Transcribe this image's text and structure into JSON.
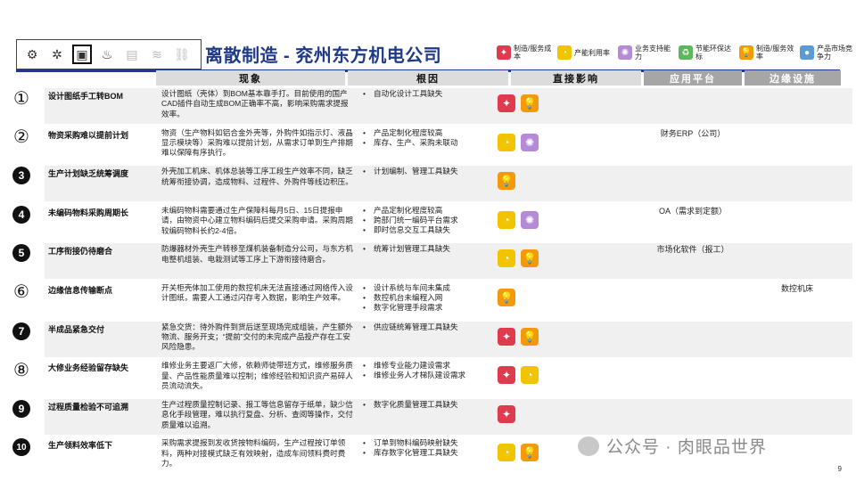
{
  "header": {
    "title": "离散制造 - 兖州东方机电公司",
    "icons": [
      "robot-arm-icon",
      "gears-icon",
      "cpu-chip-icon",
      "water-drop-icon",
      "server-icon",
      "waves-icon",
      "link-icon"
    ],
    "active_icon": "cpu-chip-icon"
  },
  "legend": [
    {
      "icon": "cost-icon",
      "label": "制造/服务成本",
      "color": "#e03a4e",
      "glyph": "✦"
    },
    {
      "icon": "capacity-icon",
      "label": "产能利用率",
      "color": "#f2c400",
      "glyph": "◔"
    },
    {
      "icon": "support-icon",
      "label": "业务支持能力",
      "color": "#b58ad6",
      "glyph": "✺"
    },
    {
      "icon": "environment-icon",
      "label": "节能环保达标",
      "color": "#5cb85c",
      "glyph": "♻"
    },
    {
      "icon": "efficiency-icon",
      "label": "制造/服务效率",
      "color": "#f39a0c",
      "glyph": "💡"
    },
    {
      "icon": "market-icon",
      "label": "产品市场竞争力",
      "color": "#5b9bd5",
      "glyph": "●"
    }
  ],
  "columns": {
    "phenomenon": "现象",
    "cause": "根因",
    "impact": "直接影响",
    "platform": "应用平台",
    "facility": "边缘设施"
  },
  "rows": [
    {
      "num": "①",
      "style": "outline",
      "problem": "设计图纸手工转BOM",
      "phenomenon": "设计图纸（壳体）到BOM基本靠手打。目前使用的国产CAD插件自动生成BOM正确率不高，影响采购需求提报效率。",
      "causes": [
        "自动化设计工具缺失"
      ],
      "impacts": [
        "cost",
        "efficiency"
      ],
      "platform": "",
      "facility": ""
    },
    {
      "num": "②",
      "style": "outline",
      "problem": "物资采购难以提前计划",
      "phenomenon": "物资（生产物料如铝合金外壳等，外购件如指示灯、液晶显示模块等）采购难以提前计划，从需求订单到生产排期难以保障有序执行。",
      "causes": [
        "产品定制化程度较高",
        "库存、生产、采购未联动"
      ],
      "impacts": [
        "capacity",
        "support"
      ],
      "platform": "财务ERP（公司）",
      "facility": ""
    },
    {
      "num": "3",
      "style": "solid",
      "problem": "生产计划缺乏统筹调度",
      "phenomenon": "外壳加工机床、机体总装等工序工段生产效率不同，缺乏统筹衔接协调，造成物料、过程件、外购件等线边积压。",
      "causes": [
        "计划编制、管理工具缺失"
      ],
      "impacts": [
        "efficiency"
      ],
      "platform": "",
      "facility": ""
    },
    {
      "num": "4",
      "style": "solid",
      "problem": "未编码物料采购周期长",
      "phenomenon": "未编码物料需要通过生产保障科每月5日、15日提报申请，由物资中心建立物料编码后提交采购申请。采购周期较编码物料长约2-4倍。",
      "causes": [
        "产品定制化程度较高",
        "跨部门统一编码平台需求",
        "即时信息交互工具缺失"
      ],
      "impacts": [
        "capacity",
        "support"
      ],
      "platform": "OA（需求到定额）",
      "facility": ""
    },
    {
      "num": "5",
      "style": "solid",
      "problem": "工序衔接仍待磨合",
      "phenomenon": "防爆器材外壳生产转移至煤机装备制造分公司，与东方机电整机组装、电栽测试等工序上下游衔接待磨合。",
      "causes": [
        "统筹计划管理工具缺失"
      ],
      "impacts": [
        "capacity",
        "efficiency"
      ],
      "platform": "市场化软件（报工）",
      "facility": ""
    },
    {
      "num": "⑥",
      "style": "outline",
      "problem": "边缘信息传输断点",
      "phenomenon": "开关柜壳体加工使用的数控机床无法直接通过网络传入设计图纸，需要人工通过闪存考入数据，影响生产效率。",
      "causes": [
        "设计系统与车间未集成",
        "数控机台未编程入网",
        "数字化管理手段需求"
      ],
      "impacts": [
        "efficiency"
      ],
      "platform": "",
      "facility": "数控机床"
    },
    {
      "num": "7",
      "style": "solid",
      "problem": "半成品紧急交付",
      "phenomenon": "紧急交货：待外购件到货后送至现场完成组装，产生额外物流、服务开支；“提前”交付的未完成产品投产存在工安风险隐患。",
      "causes": [
        "供应链统筹管理工具缺失"
      ],
      "impacts": [
        "cost",
        "efficiency"
      ],
      "platform": "",
      "facility": ""
    },
    {
      "num": "⑧",
      "style": "outline",
      "problem": "大修业务经验留存缺失",
      "phenomenon": "维修业务主要返厂大修，依赖师徒带班方式，维修服务质量、产品性能质量难以控制；维修经验和知识资产易碎人员流动流失。",
      "causes": [
        "维修专业能力建设需求",
        "维修业务人才梯队建设需求"
      ],
      "impacts": [
        "cost",
        "capacity"
      ],
      "platform": "",
      "facility": ""
    },
    {
      "num": "9",
      "style": "solid",
      "problem": "过程质量检验不可追溯",
      "phenomenon": "生产过程质量控制记录、报工等信息留存于纸单，缺少信息化手段管理，难以执行复盘、分析、查阅等操作，交付质量难以追溯。",
      "causes": [
        "数字化质量管理工具缺失"
      ],
      "impacts": [
        "cost"
      ],
      "platform": "",
      "facility": ""
    },
    {
      "num": "10",
      "style": "solid",
      "problem": "生产领料效率低下",
      "phenomenon": "采购需求提报到发收货按物料编码，生产过程按订单领料，两种对接模式缺乏有效映射，造成车间领料费时费力。",
      "causes": [
        "订单到物料编码映射缺失",
        "库存数字化管理工具缺失"
      ],
      "impacts": [
        "capacity",
        "efficiency"
      ],
      "platform": "",
      "facility": ""
    }
  ],
  "watermark": "公众号 · 肉眼品世界",
  "page_number": "9"
}
